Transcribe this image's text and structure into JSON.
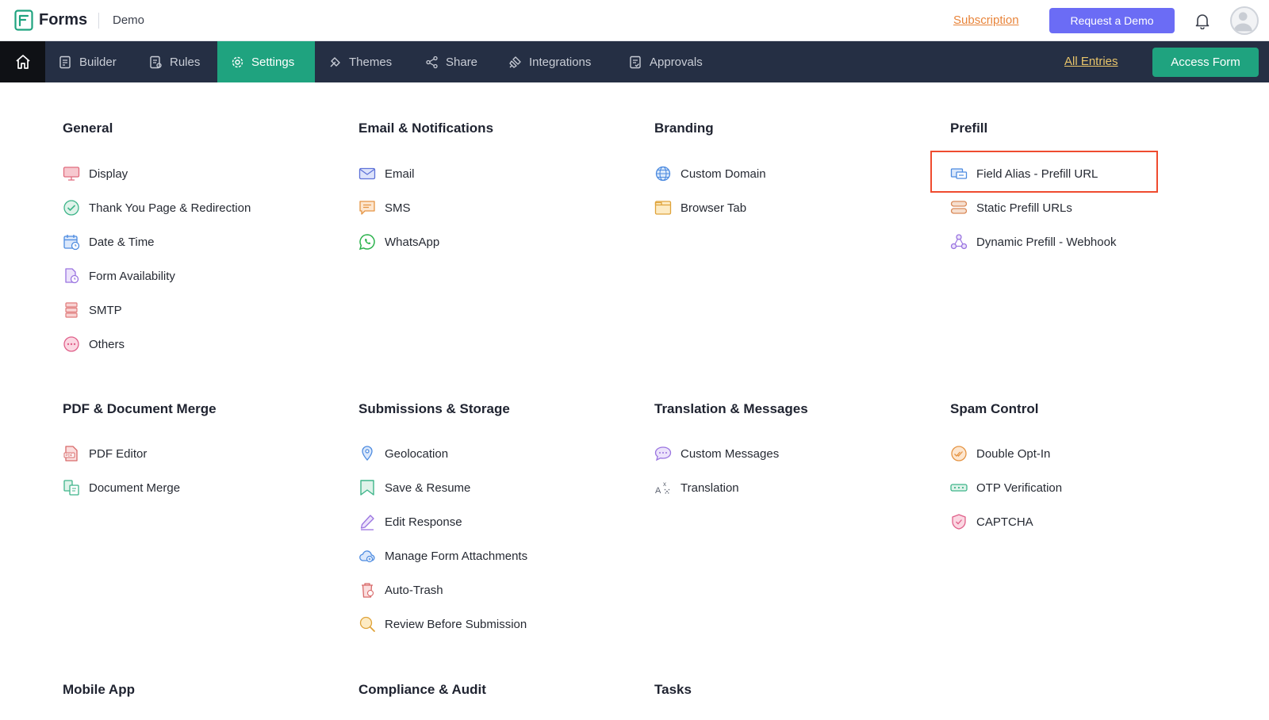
{
  "topbar": {
    "app_name": "Forms",
    "form_name": "Demo",
    "subscription_label": "Subscription",
    "request_demo_label": "Request a Demo"
  },
  "nav": {
    "tabs": [
      {
        "label": "Builder",
        "icon": "builder-icon"
      },
      {
        "label": "Rules",
        "icon": "rules-icon"
      },
      {
        "label": "Settings",
        "icon": "gear-icon",
        "active": true
      },
      {
        "label": "Themes",
        "icon": "themes-icon"
      },
      {
        "label": "Share",
        "icon": "share-icon"
      },
      {
        "label": "Integrations",
        "icon": "integrations-icon"
      },
      {
        "label": "Approvals",
        "icon": "approvals-icon"
      }
    ],
    "all_entries_label": "All Entries",
    "access_form_label": "Access Form"
  },
  "sections": {
    "general": {
      "title": "General",
      "items": [
        "Display",
        "Thank You Page & Redirection",
        "Date & Time",
        "Form Availability",
        "SMTP",
        "Others"
      ]
    },
    "email": {
      "title": "Email & Notifications",
      "items": [
        "Email",
        "SMS",
        "WhatsApp"
      ]
    },
    "branding": {
      "title": "Branding",
      "items": [
        "Custom Domain",
        "Browser Tab"
      ]
    },
    "prefill": {
      "title": "Prefill",
      "items": [
        "Field Alias - Prefill URL",
        "Static Prefill URLs",
        "Dynamic Prefill - Webhook"
      ]
    },
    "pdf": {
      "title": "PDF & Document Merge",
      "items": [
        "PDF Editor",
        "Document Merge"
      ]
    },
    "submissions": {
      "title": "Submissions & Storage",
      "items": [
        "Geolocation",
        "Save & Resume",
        "Edit Response",
        "Manage Form Attachments",
        "Auto-Trash",
        "Review Before Submission"
      ]
    },
    "translation": {
      "title": "Translation & Messages",
      "items": [
        "Custom Messages",
        "Translation"
      ]
    },
    "spam": {
      "title": "Spam Control",
      "items": [
        "Double Opt-In",
        "OTP Verification",
        "CAPTCHA"
      ]
    },
    "mobile": {
      "title": "Mobile App"
    },
    "compliance": {
      "title": "Compliance & Audit"
    },
    "tasks": {
      "title": "Tasks"
    }
  },
  "colors": {
    "nav_bg": "#252f44",
    "accent_green": "#1fa37f",
    "demo_purple": "#6b6cf5",
    "subscription_orange": "#e8843a",
    "highlight_red": "#ef4b2f"
  }
}
